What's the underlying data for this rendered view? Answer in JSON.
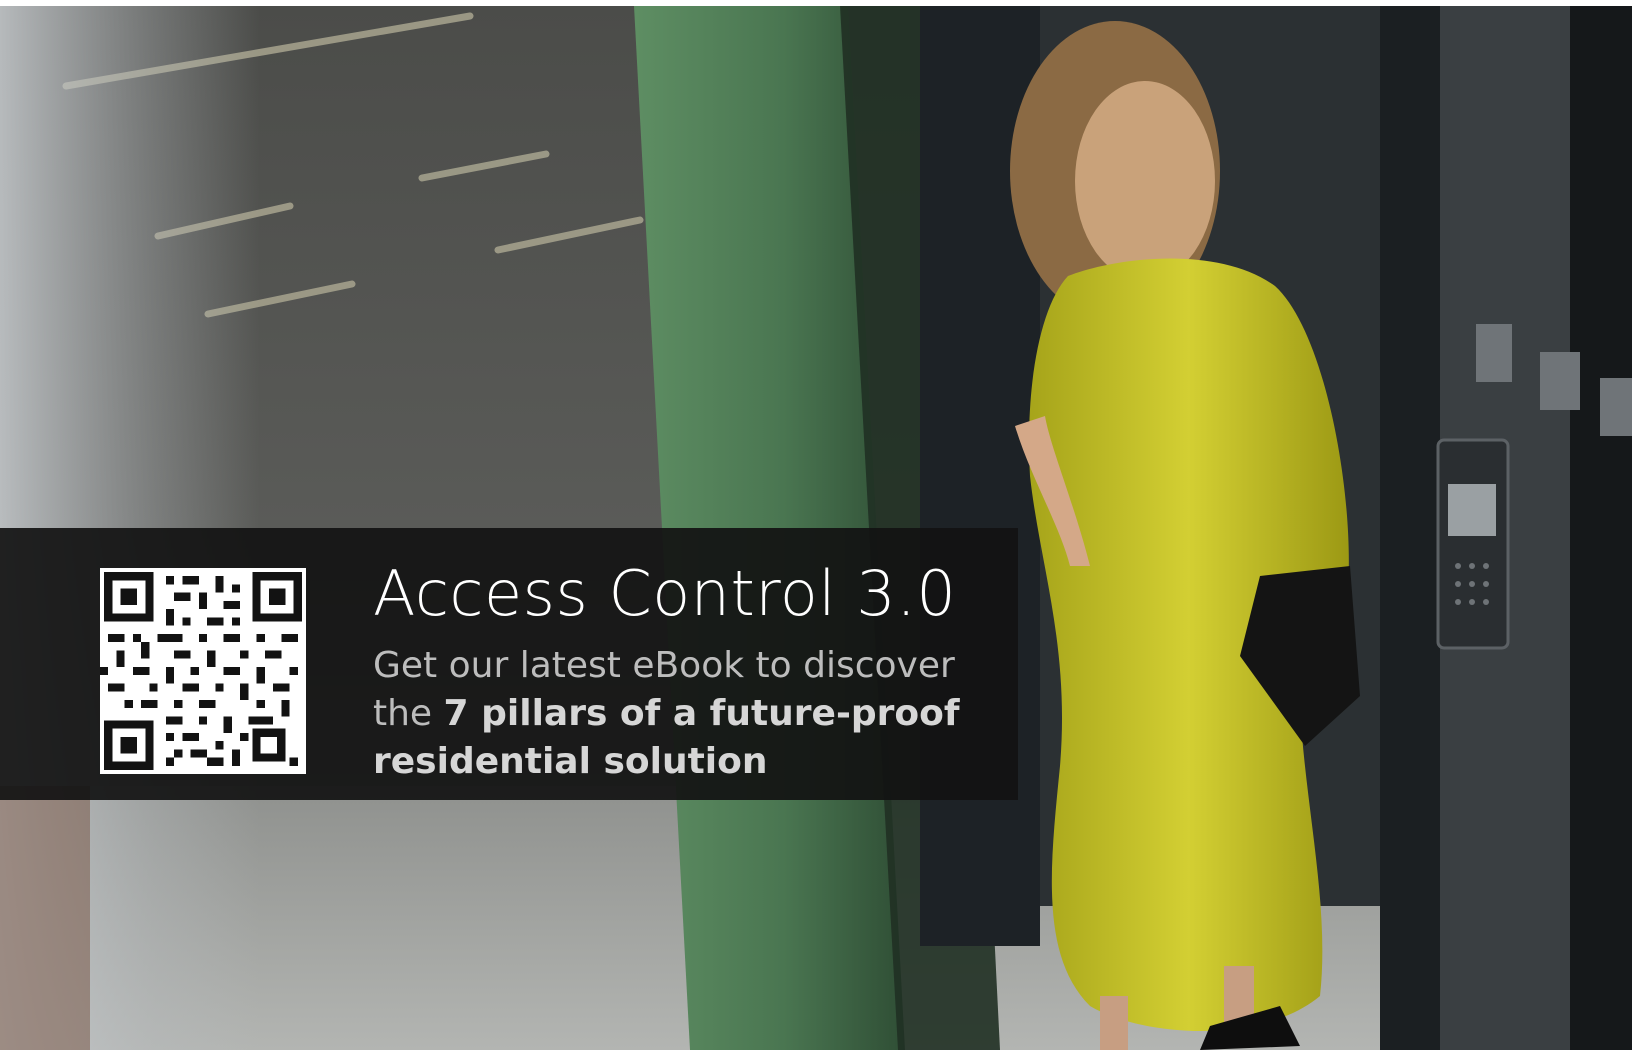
{
  "banner": {
    "headline": "Access Control 3.0",
    "line1": "Get our latest eBook to discover",
    "line2_lead": "the ",
    "line2_emphasis": "7 pillars of a future-proof",
    "line3": "residential solution"
  },
  "qr_code": {
    "icon": "qr-code-icon"
  },
  "colors": {
    "banner_background": "#121212",
    "headline": "#ffffff",
    "body_text": "#bdbdbd",
    "dress": "#c9c52a",
    "column": "#4f7a55"
  }
}
